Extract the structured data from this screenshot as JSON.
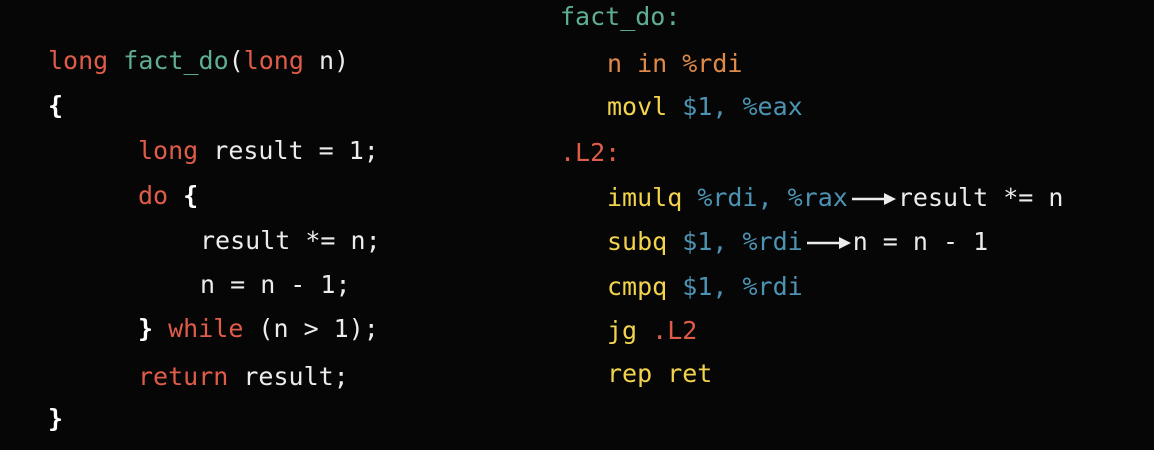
{
  "c_code": {
    "l1_kw": "long",
    "l1_fn": "fact_do",
    "l1_paren_open": "(",
    "l1_kw2": "long",
    "l1_arg": " n)",
    "l2_brace": "{",
    "l3_kw": "long",
    "l3_rest": " result = 1;",
    "l4_kw": "do",
    "l4_brace": " {",
    "l5": "result *= n;",
    "l6": "n = n - 1;",
    "l7_brace": "}",
    "l7_kw": " while",
    "l7_rest": " (n > 1);",
    "l8_kw": "return",
    "l8_rest": " result;",
    "l9_brace": "}"
  },
  "asm": {
    "label1": "fact_do:",
    "note": "n in %rdi",
    "mov_op": "movl",
    "mov_args": " $1, %eax",
    "label2": ".L2:",
    "imul_op": "imulq",
    "imul_args": " %rdi, %rax",
    "imul_note": "result *= n",
    "sub_op": "subq",
    "sub_args": " $1, %rdi",
    "sub_note": "n = n - 1",
    "cmp_op": "cmpq",
    "cmp_args": " $1, %rdi",
    "jg_op": "jg",
    "jg_arg": " .L2",
    "ret_op": "rep ret"
  },
  "colors": {
    "keyword": "#e05c4a",
    "function": "#5fae91",
    "opcode": "#f2d34e",
    "register": "#4d93b3",
    "background": "#060606"
  }
}
